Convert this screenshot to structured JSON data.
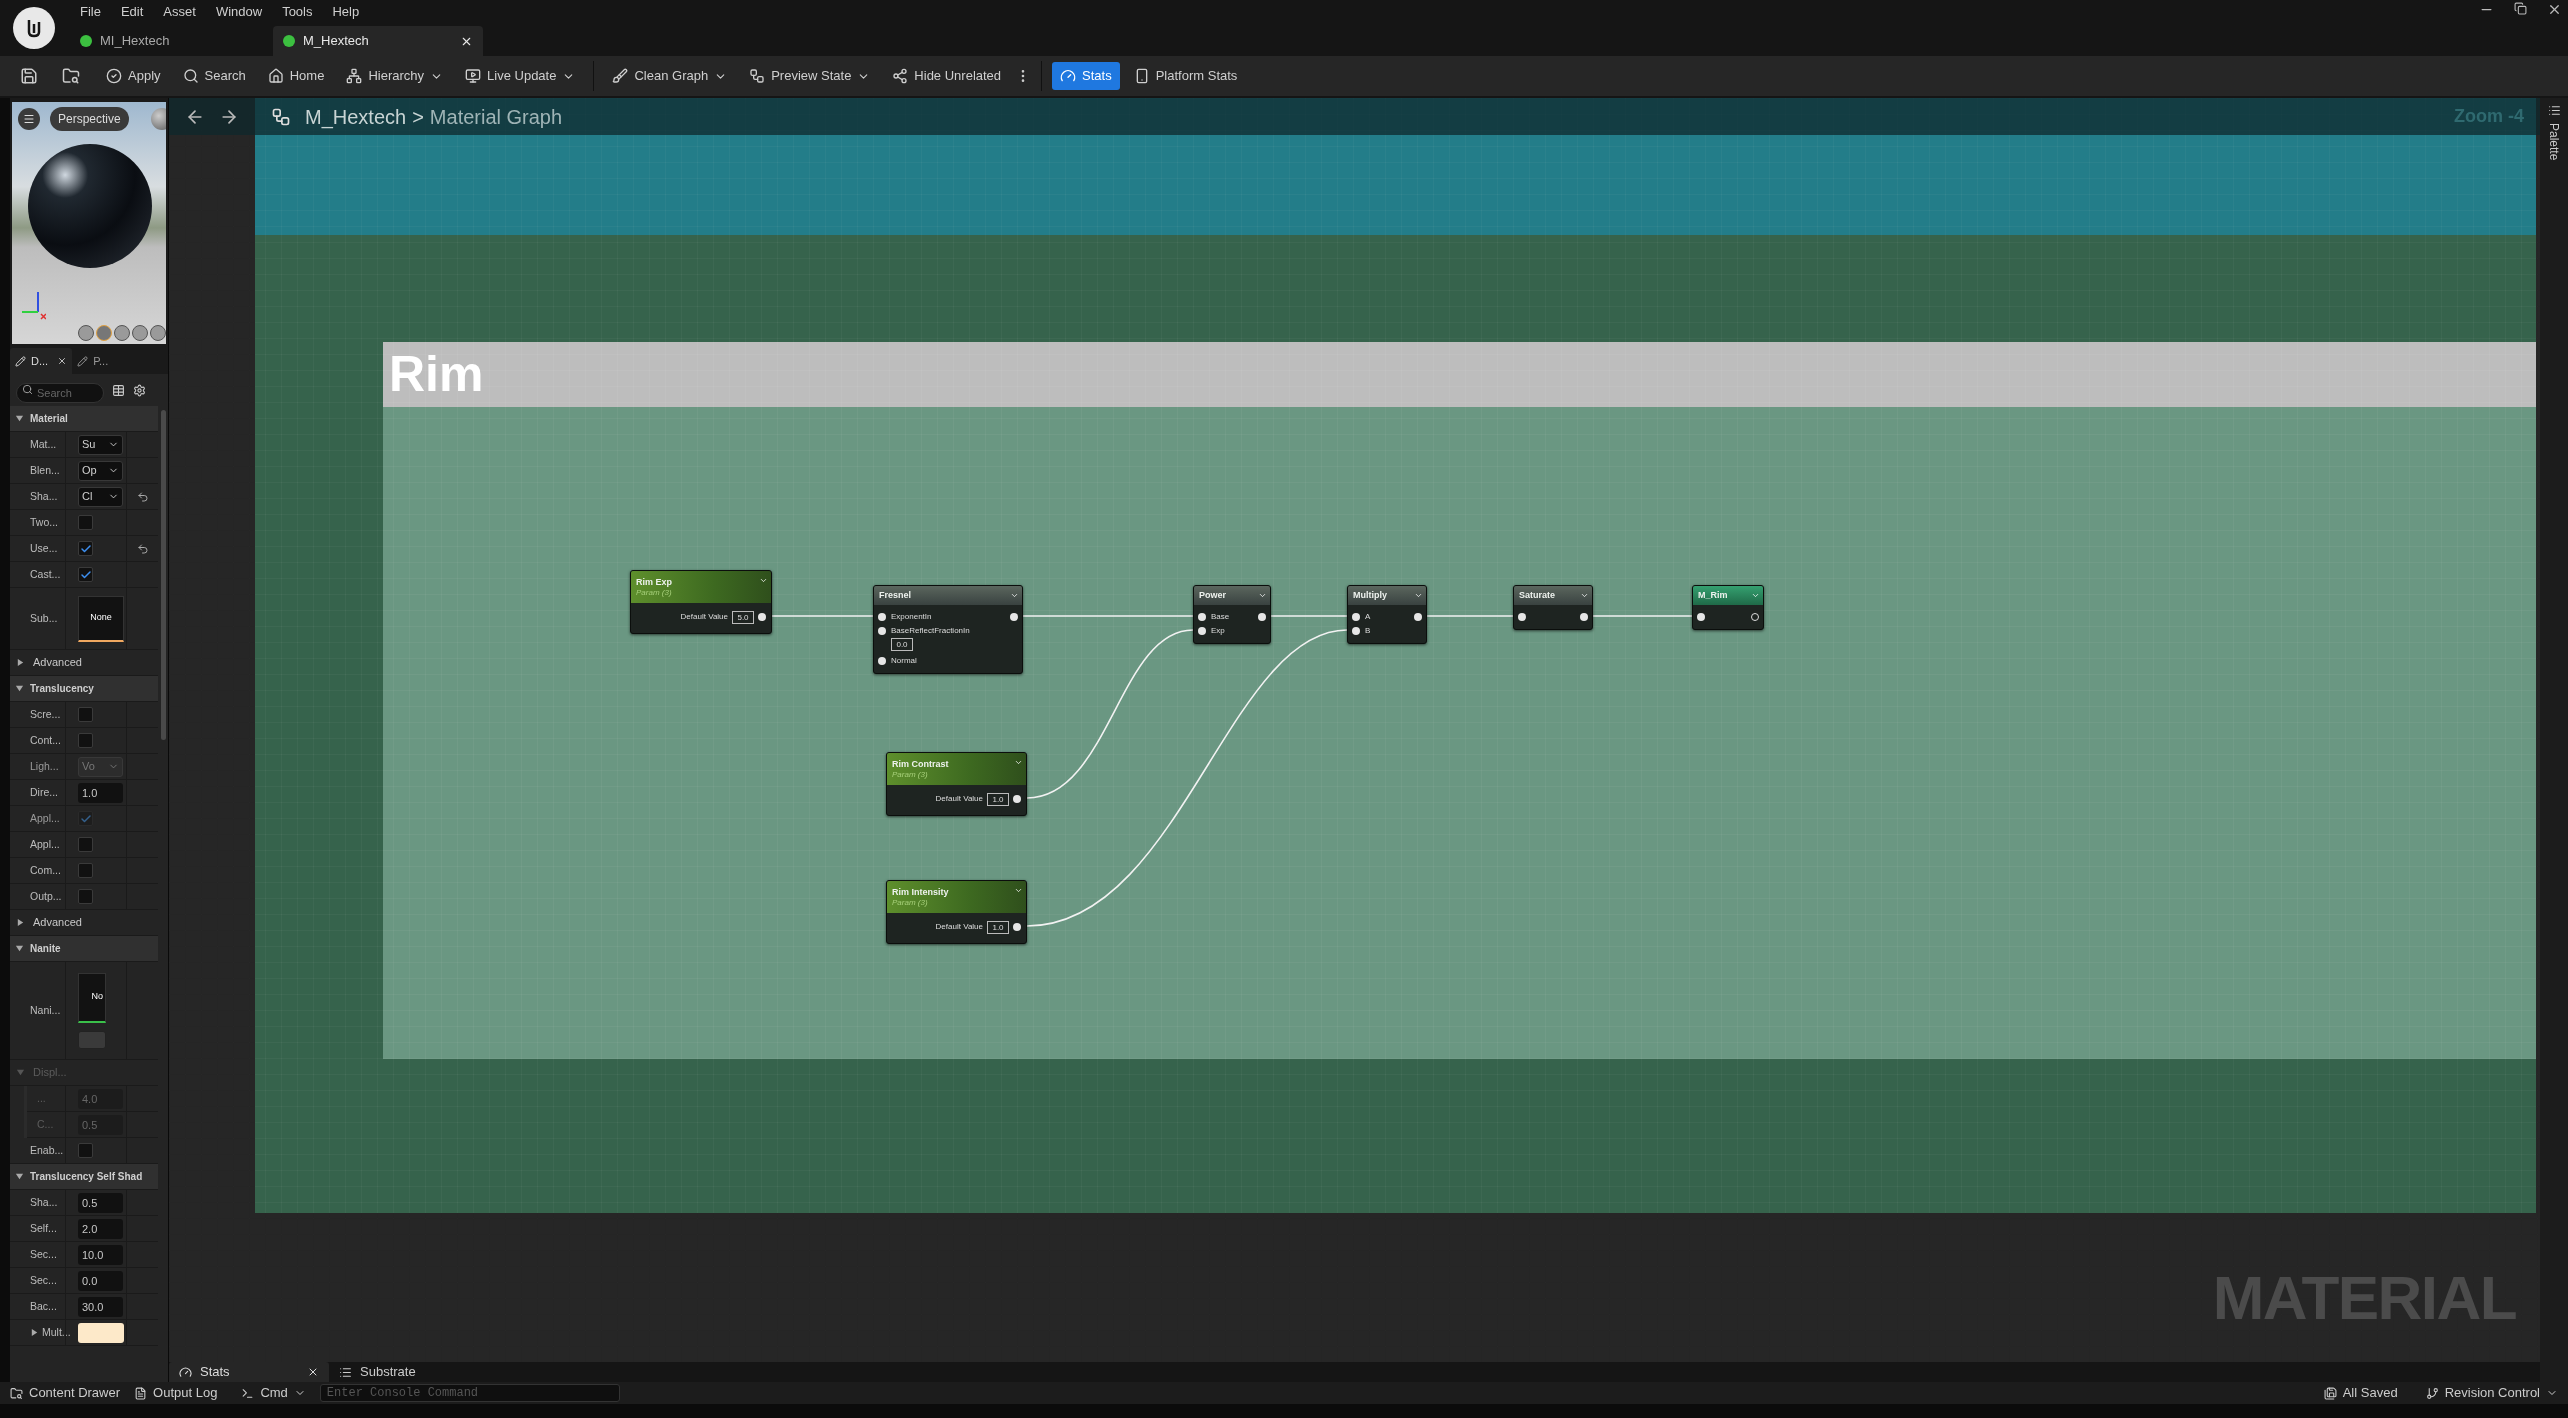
{
  "menu": [
    "File",
    "Edit",
    "Asset",
    "Window",
    "Tools",
    "Help"
  ],
  "document_tabs": [
    {
      "label": "MI_Hextech",
      "selected": false
    },
    {
      "label": "M_Hextech",
      "selected": true
    }
  ],
  "toolbar": [
    {
      "label": "Apply",
      "dropdown": false,
      "selected": false
    },
    {
      "label": "Search",
      "dropdown": false,
      "selected": false
    },
    {
      "label": "Home",
      "dropdown": false,
      "selected": false
    },
    {
      "label": "Hierarchy",
      "dropdown": true,
      "selected": false
    },
    {
      "label": "Live Update",
      "dropdown": true,
      "selected": false
    },
    {
      "label": "Clean Graph",
      "dropdown": true,
      "selected": false
    },
    {
      "label": "Preview State",
      "dropdown": true,
      "selected": false
    },
    {
      "label": "Hide Unrelated",
      "dropdown": false,
      "selected": false
    },
    {
      "label": "Stats",
      "dropdown": false,
      "selected": true
    },
    {
      "label": "Platform Stats",
      "dropdown": false,
      "selected": false
    }
  ],
  "viewport": {
    "mode": "Perspective"
  },
  "details": {
    "tabs": [
      {
        "label": "D...",
        "selected": true,
        "closable": true
      },
      {
        "label": "P...",
        "selected": false,
        "closable": false
      }
    ],
    "search_placeholder": "Search",
    "sections": [
      {
        "title": "Material",
        "expanded": true,
        "rows": [
          {
            "kind": "dropdown",
            "label": "Mat...",
            "value": "Su",
            "reset": false,
            "disabled": false
          },
          {
            "kind": "dropdown",
            "label": "Blen...",
            "value": "Op",
            "reset": false,
            "disabled": false
          },
          {
            "kind": "dropdown",
            "label": "Sha...",
            "value": "Cl",
            "reset": true,
            "disabled": false
          },
          {
            "kind": "checkbox",
            "label": "Two...",
            "checked": false,
            "reset": false,
            "disabled": false
          },
          {
            "kind": "checkbox",
            "label": "Use...",
            "checked": true,
            "reset": true,
            "disabled": false
          },
          {
            "kind": "checkbox",
            "label": "Cast...",
            "checked": true,
            "reset": false,
            "disabled": false
          },
          {
            "kind": "texture",
            "label": "Sub...",
            "value": "None",
            "reset": false,
            "disabled": false
          },
          {
            "kind": "group",
            "label": "Advanced",
            "expanded": false,
            "disabled": false
          }
        ]
      },
      {
        "title": "Translucency",
        "expanded": true,
        "rows": [
          {
            "kind": "checkbox",
            "label": "Scre...",
            "checked": false,
            "reset": false,
            "disabled": false
          },
          {
            "kind": "checkbox",
            "label": "Cont...",
            "checked": false,
            "reset": false,
            "disabled": false
          },
          {
            "kind": "dropdown",
            "label": "Ligh...",
            "value": "Vo",
            "reset": false,
            "disabled": true
          },
          {
            "kind": "number",
            "label": "Dire...",
            "value": "1.0",
            "reset": false,
            "disabled": false
          },
          {
            "kind": "checkbox",
            "label": "Appl...",
            "checked": true,
            "reset": false,
            "disabled": true
          },
          {
            "kind": "checkbox",
            "label": "Appl...",
            "checked": false,
            "reset": false,
            "disabled": false
          },
          {
            "kind": "checkbox",
            "label": "Com...",
            "checked": false,
            "reset": false,
            "disabled": false
          },
          {
            "kind": "checkbox",
            "label": "Outp...",
            "checked": false,
            "reset": false,
            "disabled": false
          },
          {
            "kind": "group",
            "label": "Advanced",
            "expanded": false,
            "disabled": false
          }
        ]
      },
      {
        "title": "Nanite",
        "expanded": true,
        "rows": [
          {
            "kind": "nanite",
            "label": "Nani...",
            "value": "No",
            "reset": false,
            "disabled": false
          },
          {
            "kind": "group",
            "label": "Displ...",
            "expanded": true,
            "disabled": true,
            "children": [
              {
                "kind": "number",
                "label": "...",
                "value": "4.0",
                "reset": false,
                "disabled": true
              },
              {
                "kind": "number",
                "label": "C...",
                "value": "0.5",
                "reset": false,
                "disabled": true
              }
            ]
          },
          {
            "kind": "checkbox",
            "label": "Enab...",
            "checked": false,
            "reset": false,
            "disabled": false
          }
        ]
      },
      {
        "title": "Translucency Self Shad",
        "expanded": true,
        "rows": [
          {
            "kind": "number",
            "label": "Sha...",
            "value": "0.5",
            "reset": false,
            "disabled": false
          },
          {
            "kind": "number",
            "label": "Self...",
            "value": "2.0",
            "reset": false,
            "disabled": false
          },
          {
            "kind": "number",
            "label": "Sec...",
            "value": "10.0",
            "reset": false,
            "disabled": false
          },
          {
            "kind": "number",
            "label": "Sec...",
            "value": "0.0",
            "reset": false,
            "disabled": false
          },
          {
            "kind": "number",
            "label": "Bac...",
            "value": "30.0",
            "reset": false,
            "disabled": false
          },
          {
            "kind": "color",
            "label": "Mult...",
            "color": "#fde9c9",
            "expanded": false,
            "reset": false,
            "disabled": false
          }
        ]
      }
    ]
  },
  "graph": {
    "breadcrumb": [
      "M_Hextech",
      "Material Graph"
    ],
    "breadcrumb_separator": ">",
    "zoom": "Zoom -4",
    "comment_title": "Rim",
    "graph_type": "MATERIAL",
    "nodes": [
      {
        "kind": "param",
        "title": "Rim Exp",
        "subtitle": "Param (3)",
        "label": "Default Value",
        "value": "5.0"
      },
      {
        "kind": "function",
        "title": "Fresnel",
        "inputs": [
          {
            "label": "ExponentIn"
          },
          {
            "label": "BaseReflectFractionIn",
            "value": "0.0"
          },
          {
            "label": "Normal"
          }
        ]
      },
      {
        "kind": "function",
        "title": "Power",
        "inputs": [
          {
            "label": "Base"
          },
          {
            "label": "Exp"
          }
        ]
      },
      {
        "kind": "function",
        "title": "Multiply",
        "inputs": [
          {
            "label": "A"
          },
          {
            "label": "B"
          }
        ]
      },
      {
        "kind": "function",
        "title": "Saturate"
      },
      {
        "kind": "output",
        "title": "M_Rim"
      },
      {
        "kind": "param",
        "title": "Rim Contrast",
        "subtitle": "Param (3)",
        "label": "Default Value",
        "value": "1.0"
      },
      {
        "kind": "param",
        "title": "Rim Intensity",
        "subtitle": "Param (3)",
        "label": "Default Value",
        "value": "1.0"
      }
    ]
  },
  "palette": {
    "label": "Palette"
  },
  "bottom_tabs": [
    {
      "label": "Stats",
      "selected": true
    },
    {
      "label": "Substrate",
      "selected": false
    }
  ],
  "status_bar": {
    "content_drawer": "Content Drawer",
    "output_log": "Output Log",
    "cmd": "Cmd",
    "console_placeholder": "Enter Console Command",
    "saved": "All Saved",
    "revision_control": "Revision Control"
  }
}
